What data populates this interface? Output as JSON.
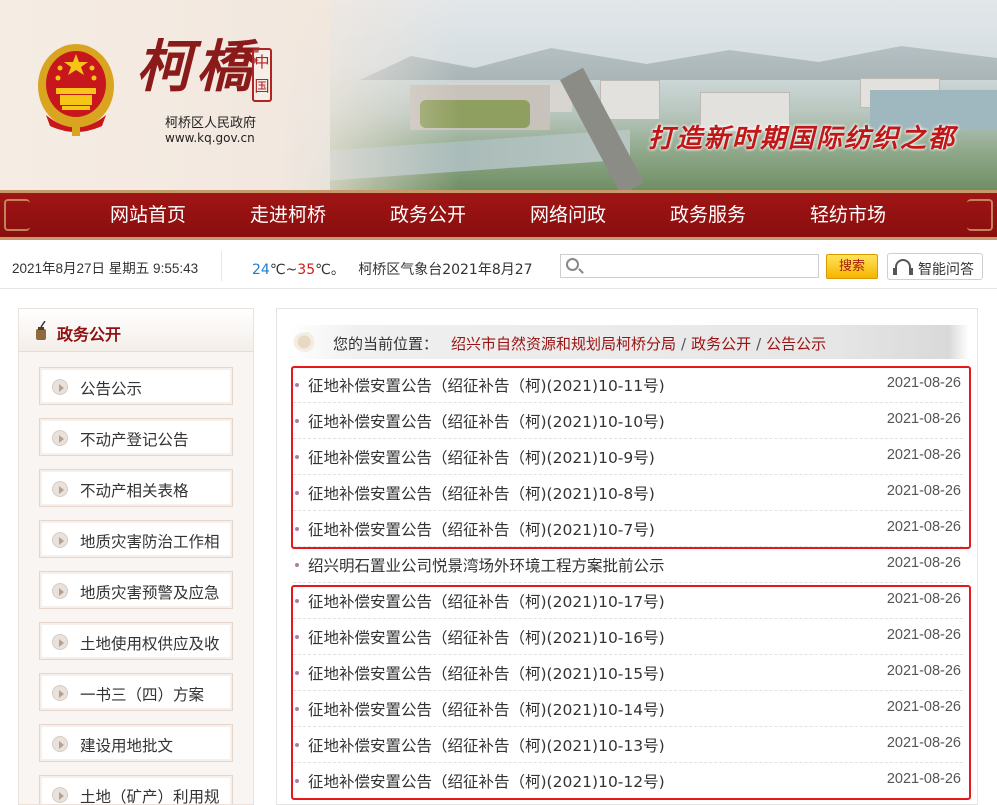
{
  "header": {
    "brand_name": "柯橋",
    "seal_text": "中国",
    "gov_name": "柯桥区人民政府",
    "gov_url": "www.kq.gov.cn",
    "slogan": "打造新时期国际纺织之都"
  },
  "nav": {
    "items": [
      "网站首页",
      "走进柯桥",
      "政务公开",
      "网络问政",
      "政务服务",
      "轻纺市场"
    ]
  },
  "infobar": {
    "datetime": "2021年8月27日 星期五 9:55:43",
    "weather_low": "24",
    "weather_sep": "℃~",
    "weather_high": "35",
    "weather_unit": "℃。",
    "weather_ticker": "柯桥区气象台2021年8月27",
    "search_placeholder": "",
    "search_button": "搜索",
    "qa_button": "智能问答"
  },
  "sidebar": {
    "title": "政务公开",
    "items": [
      "公告公示",
      "不动产登记公告",
      "不动产相关表格",
      "地质灾害防治工作相",
      "地质灾害预警及应急",
      "土地使用权供应及收",
      "一书三（四）方案",
      "建设用地批文",
      "土地（矿产）利用规"
    ]
  },
  "breadcrumb": {
    "prefix": "您的当前位置：",
    "items": [
      "绍兴市自然资源和规划局柯桥分局",
      "政务公开",
      "公告公示"
    ],
    "separator": "/"
  },
  "articles": [
    {
      "title": "征地补偿安置公告（绍征补告（柯)(2021)10-11号)",
      "date": "2021-08-26"
    },
    {
      "title": "征地补偿安置公告（绍征补告（柯)(2021)10-10号)",
      "date": "2021-08-26"
    },
    {
      "title": "征地补偿安置公告（绍征补告（柯)(2021)10-9号)",
      "date": "2021-08-26"
    },
    {
      "title": "征地补偿安置公告（绍征补告（柯)(2021)10-8号)",
      "date": "2021-08-26"
    },
    {
      "title": "征地补偿安置公告（绍征补告（柯)(2021)10-7号)",
      "date": "2021-08-26"
    },
    {
      "title": "绍兴明石置业公司悦景湾场外环境工程方案批前公示",
      "date": "2021-08-26"
    },
    {
      "title": "征地补偿安置公告（绍征补告（柯)(2021)10-17号)",
      "date": "2021-08-26"
    },
    {
      "title": "征地补偿安置公告（绍征补告（柯)(2021)10-16号)",
      "date": "2021-08-26"
    },
    {
      "title": "征地补偿安置公告（绍征补告（柯)(2021)10-15号)",
      "date": "2021-08-26"
    },
    {
      "title": "征地补偿安置公告（绍征补告（柯)(2021)10-14号)",
      "date": "2021-08-26"
    },
    {
      "title": "征地补偿安置公告（绍征补告（柯)(2021)10-13号)",
      "date": "2021-08-26"
    },
    {
      "title": "征地补偿安置公告（绍征补告（柯)(2021)10-12号)",
      "date": "2021-08-26"
    }
  ],
  "colors": {
    "brand_red": "#8b1a1a",
    "nav_red": "#a01515",
    "highlight_box": "#e3191c",
    "crumb_link": "#9b1212",
    "search_button_yellow": "#f6b400"
  }
}
